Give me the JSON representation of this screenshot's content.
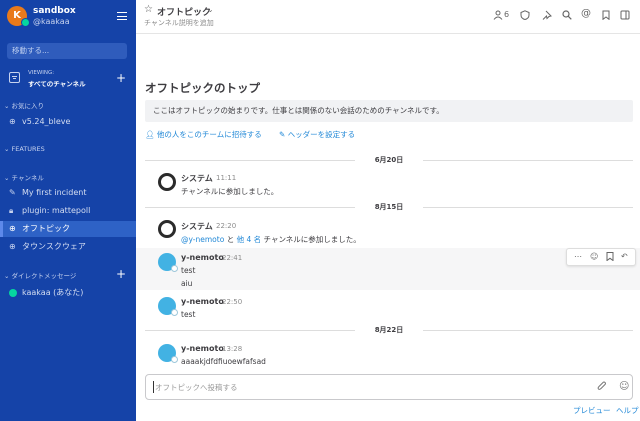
{
  "sidebar": {
    "avatar_initial": "K",
    "team_name": "sandbox",
    "user_name": "@kaakaa",
    "search_placeholder": "移動する...",
    "views_top": "VIEWING:",
    "views_bottom": "すべてのチャンネル",
    "favorites_header": "お気に入り",
    "favorites": [
      {
        "label": "v5.24_bleve",
        "icon": "globe-icon"
      }
    ],
    "features_header": "FEATURES",
    "channels_header": "チャンネル",
    "channels": [
      {
        "label": "My first incident",
        "icon": "pencil-icon"
      },
      {
        "label": "plugin: mattepoll",
        "icon": "lock-icon"
      },
      {
        "label": "オフトピック",
        "icon": "globe-icon",
        "active": true
      },
      {
        "label": "タウンスクウェア",
        "icon": "globe-icon"
      }
    ],
    "dm_header": "ダイレクトメッセージ",
    "dms": [
      {
        "label": "kaakaa (あなた)"
      }
    ]
  },
  "header": {
    "channel_name": "オフトピック",
    "channel_description": "チャンネル説明を追加",
    "member_count": "6"
  },
  "intro": {
    "title": "オフトピックのトップ",
    "description": "ここはオフトピックの始まりです。仕事とは関係のない会話のためのチャンネルです。",
    "invite_link": "他の人をこのチームに招待する",
    "header_link": "ヘッダーを設定する"
  },
  "dates": {
    "d1": "6月20日",
    "d2": "8月15日",
    "d3": "8月22日"
  },
  "posts": {
    "p1": {
      "name": "システム",
      "time": "11:11",
      "text": "チャンネルに参加しました。"
    },
    "p2": {
      "name": "システム",
      "time": "22:20",
      "mention": "@y-nemoto",
      "and": "と",
      "others": "他 4 名",
      "text": "チャンネルに参加しました。"
    },
    "p3": {
      "name": "y-nemoto",
      "time": "22:41",
      "line1": "test",
      "line2": "aiu"
    },
    "p4": {
      "name": "y-nemoto",
      "time": "22:50",
      "text": "test"
    },
    "p5": {
      "name": "y-nemoto",
      "time": "13:28",
      "text": "aaaakjdfdfiuoewfafsad"
    }
  },
  "composer": {
    "placeholder": "オフトピックへ投稿する",
    "preview": "プレビュー",
    "help": "ヘルプ"
  },
  "colors": {
    "sidebar": "#1543a8",
    "active_item": "#2e62c6",
    "link": "#2389d7",
    "online": "#06d6a0"
  }
}
